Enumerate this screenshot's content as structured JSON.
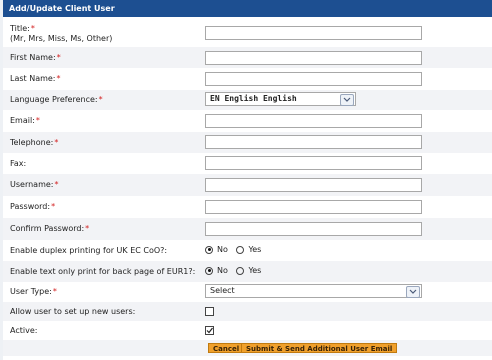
{
  "form": {
    "title": "Add/Update Client User",
    "required_mark": "*",
    "fields": {
      "title": {
        "label": "Title:",
        "hint": "(Mr, Mrs, Miss, Ms, Other)",
        "value": ""
      },
      "first_name": {
        "label": "First Name:",
        "value": ""
      },
      "last_name": {
        "label": "Last Name:",
        "value": ""
      },
      "language": {
        "label": "Language Preference:",
        "value": "EN English English"
      },
      "email": {
        "label": "Email:",
        "value": ""
      },
      "telephone": {
        "label": "Telephone:",
        "value": ""
      },
      "fax": {
        "label": "Fax:",
        "value": ""
      },
      "username": {
        "label": "Username:",
        "value": ""
      },
      "password": {
        "label": "Password:",
        "value": ""
      },
      "confirm_password": {
        "label": "Confirm Password:",
        "value": ""
      },
      "duplex": {
        "label": "Enable duplex printing for UK EC CoO?:",
        "no": "No",
        "yes": "Yes",
        "selected": "No"
      },
      "text_only": {
        "label": "Enable text only print for back page of EUR1?:",
        "no": "No",
        "yes": "Yes",
        "selected": "No"
      },
      "user_type": {
        "label": "User Type:",
        "value": "Select"
      },
      "allow_setup": {
        "label": "Allow user to set up new users:",
        "checked": false
      },
      "active": {
        "label": "Active:",
        "checked": true
      }
    },
    "buttons": {
      "cancel": "Cancel",
      "submit": "Submit & Send Additional User Email"
    }
  },
  "colors": {
    "header": "#1d4f91",
    "required": "#d21c1c",
    "button": "#f0a02c"
  }
}
